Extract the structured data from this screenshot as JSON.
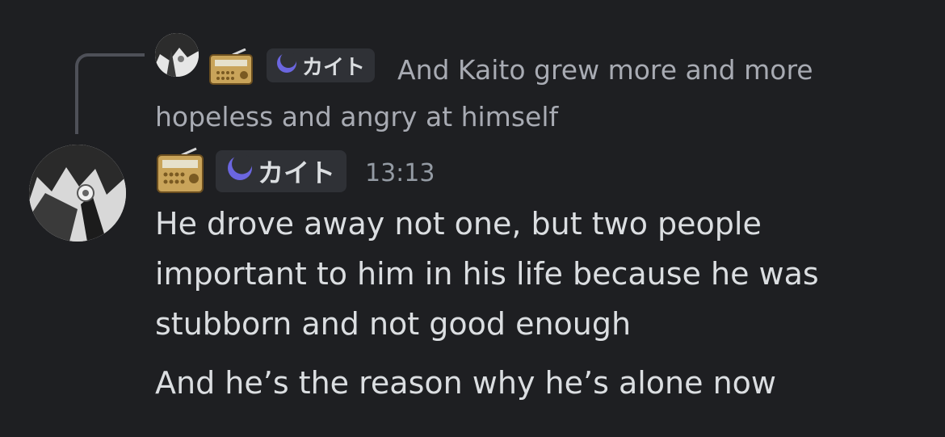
{
  "reply": {
    "badge_label": "カイト",
    "text": "And Kaito grew more and more hopeless and angry at himself"
  },
  "message": {
    "badge_label": "カイト",
    "timestamp": "13:13",
    "lines": [
      "He drove away not one, but two people important to him in his life because he was stubborn and not good enough",
      "And he’s the reason why he’s alone now"
    ]
  },
  "icons": {
    "role_icon": "radio-icon",
    "badge_icon": "crescent-moon-icon"
  },
  "colors": {
    "background": "#1e1f22",
    "badge_background": "#2f3136",
    "moon": "#6b66e0",
    "radio": "#c9a45a"
  }
}
